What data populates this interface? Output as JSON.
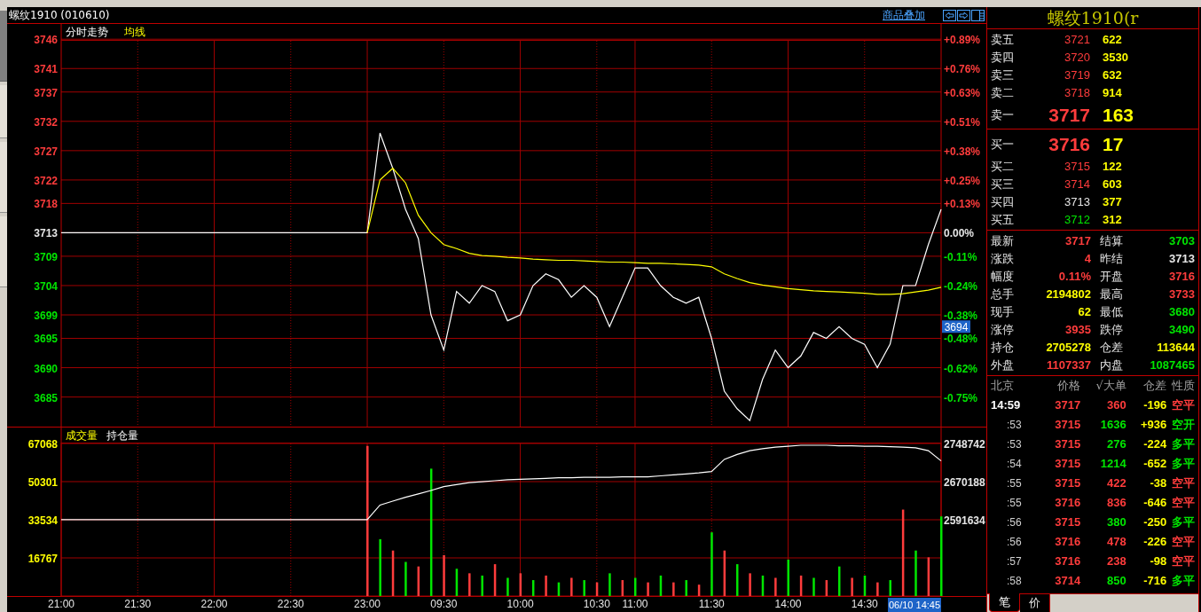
{
  "sidebar_tabs": [
    {
      "selected": true
    },
    {
      "selected": false
    },
    {
      "selected": false
    },
    {
      "selected": false
    }
  ],
  "header": {
    "title": "螺纹1910 (010610)",
    "overlay_link": "商品叠加"
  },
  "price_chart": {
    "percent_ticks": [
      {
        "label": "+0.89%",
        "color": "#ff3c3c"
      },
      {
        "label": "+0.76%",
        "color": "#ff3c3c"
      },
      {
        "label": "+0.63%",
        "color": "#ff3c3c"
      },
      {
        "label": "+0.51%",
        "color": "#ff3c3c"
      },
      {
        "label": "+0.38%",
        "color": "#ff3c3c"
      },
      {
        "label": "+0.25%",
        "color": "#ff3c3c"
      },
      {
        "label": "+0.13%",
        "color": "#ff3c3c"
      },
      {
        "label": "0.00%",
        "color": "#e6e6e6"
      },
      {
        "label": "-0.11%",
        "color": "#00e600"
      },
      {
        "label": "-0.24%",
        "color": "#00e600"
      },
      {
        "label": "-0.38%",
        "color": "#00e600"
      },
      {
        "label": "-0.48%",
        "color": "#00e600"
      },
      {
        "label": "-0.62%",
        "color": "#00e600"
      },
      {
        "label": "-0.75%",
        "color": "#00e600"
      }
    ],
    "chart_data": {
      "type": "line",
      "grid": true,
      "ylim": [
        3679.8,
        3748.6
      ],
      "yticks": [
        3746,
        3741,
        3737,
        3732,
        3727,
        3722,
        3718,
        3713,
        3709,
        3704,
        3699,
        3695,
        3690,
        3685
      ],
      "categories": [
        null,
        null,
        null,
        null,
        null,
        null,
        null,
        null,
        null,
        null,
        null,
        null,
        null,
        null,
        null,
        null,
        null,
        null,
        null,
        null,
        null,
        null,
        null,
        null,
        null,
        null,
        null,
        null,
        null,
        null,
        null,
        null,
        null,
        null,
        null,
        null,
        null,
        null,
        null,
        null,
        null,
        null,
        null,
        null,
        null,
        null,
        null,
        null,
        null,
        null,
        null,
        null,
        null,
        null,
        null,
        null,
        null,
        null,
        null,
        null,
        null,
        null,
        null,
        null,
        null,
        null,
        null,
        null,
        null,
        null
      ],
      "series": [
        {
          "name": "分时走势",
          "color": "#ffffff",
          "values": [
            3713,
            3713,
            3713,
            3713,
            3713,
            3713,
            3713,
            3713,
            3713,
            3713,
            3713,
            3713,
            3713,
            3713,
            3713,
            3713,
            3713,
            3713,
            3713,
            3713,
            3713,
            3713,
            3713,
            3713,
            3713,
            3730,
            3724,
            3717,
            3712,
            3699,
            3693,
            3703,
            3701,
            3704,
            3703,
            3698,
            3699,
            3704,
            3706,
            3705,
            3702,
            3704,
            3702,
            3697,
            3702,
            3707,
            3707,
            3704,
            3702,
            3701,
            3702,
            3695,
            3686,
            3683,
            3681,
            3688,
            3693,
            3690,
            3692,
            3696,
            3695,
            3697,
            3695,
            3694,
            3690,
            3694,
            3704,
            3704,
            3711,
            3717
          ]
        },
        {
          "name": "均线",
          "color": "#ffff00",
          "values": [
            null,
            null,
            null,
            null,
            null,
            null,
            null,
            null,
            null,
            null,
            null,
            null,
            null,
            null,
            null,
            null,
            null,
            null,
            null,
            null,
            null,
            null,
            null,
            null,
            3713,
            3722,
            3724,
            3721.5,
            3716,
            3713,
            3711,
            3710.3,
            3709.5,
            3709.1,
            3709,
            3708.8,
            3708.7,
            3708.5,
            3708.4,
            3708.3,
            3708.3,
            3708.2,
            3708.1,
            3708,
            3708,
            3707.9,
            3707.8,
            3707.8,
            3707.7,
            3707.6,
            3707.5,
            3707.2,
            3706,
            3705.2,
            3704.5,
            3704.1,
            3703.8,
            3703.5,
            3703.3,
            3703.1,
            3703,
            3702.9,
            3702.8,
            3702.7,
            3702.5,
            3702.5,
            3702.6,
            3702.9,
            3703.2,
            3703.7
          ]
        }
      ]
    }
  },
  "volume_chart": {
    "legend_label": "成交量",
    "chart_data": {
      "type": "bar",
      "grid": true,
      "ylim": [
        0,
        67068
      ],
      "yticks": [
        67068,
        50301,
        33534,
        16767
      ],
      "categories": [
        "21:00",
        null,
        null,
        null,
        null,
        null,
        "21:30",
        null,
        null,
        null,
        null,
        null,
        "22:00",
        null,
        null,
        null,
        null,
        null,
        "22:30",
        null,
        null,
        null,
        null,
        null,
        "23:00",
        null,
        null,
        null,
        null,
        null,
        "09:30",
        null,
        null,
        null,
        null,
        null,
        "10:00",
        null,
        null,
        null,
        null,
        null,
        "10:30",
        null,
        null,
        "11:00",
        null,
        null,
        null,
        null,
        null,
        "11:30",
        null,
        null,
        null,
        null,
        null,
        "14:00",
        null,
        null,
        null,
        null,
        null,
        "14:30",
        null,
        null,
        null,
        null,
        null,
        null
      ],
      "series": [
        {
          "color": "#ff3c3c",
          "values": [
            null,
            null,
            null,
            null,
            null,
            null,
            null,
            null,
            null,
            null,
            null,
            null,
            null,
            null,
            null,
            null,
            null,
            null,
            null,
            null,
            null,
            null,
            null,
            null,
            66000,
            null,
            20000,
            null,
            13000,
            null,
            18000,
            null,
            10000,
            null,
            14000,
            null,
            10000,
            null,
            9000,
            null,
            8000,
            null,
            6000,
            null,
            7000,
            null,
            6000,
            null,
            6000,
            null,
            5000,
            null,
            20000,
            null,
            10000,
            null,
            8000,
            null,
            9000,
            null,
            7000,
            null,
            8000,
            null,
            6000,
            null,
            38000,
            null,
            17000,
            null
          ]
        },
        {
          "color": "#00e600",
          "values": [
            null,
            null,
            null,
            null,
            null,
            null,
            null,
            null,
            null,
            null,
            null,
            null,
            null,
            null,
            null,
            null,
            null,
            null,
            null,
            null,
            null,
            null,
            null,
            null,
            null,
            25000,
            null,
            15000,
            null,
            56000,
            null,
            12000,
            null,
            9000,
            null,
            8000,
            null,
            7000,
            null,
            6000,
            null,
            7000,
            null,
            10000,
            null,
            8000,
            null,
            9000,
            null,
            7000,
            null,
            28000,
            null,
            14000,
            null,
            9000,
            null,
            16000,
            null,
            8000,
            null,
            13000,
            null,
            9000,
            null,
            7000,
            null,
            20000,
            null,
            35000
          ]
        }
      ]
    }
  },
  "open_interest_chart": {
    "chart_data": {
      "type": "line",
      "grid": true,
      "ylim": [
        2434526,
        2748742
      ],
      "yticks": [
        2748742,
        2670188,
        2591634
      ],
      "categories": [
        null,
        null,
        null,
        null,
        null,
        null,
        null,
        null,
        null,
        null,
        null,
        null,
        null,
        null,
        null,
        null,
        null,
        null,
        null,
        null,
        null,
        null,
        null,
        null,
        null,
        null,
        null,
        null,
        null,
        null,
        null,
        null,
        null,
        null,
        null,
        null,
        null,
        null,
        null,
        null,
        null,
        null,
        null,
        null,
        null,
        null,
        null,
        null,
        null,
        null,
        null,
        null,
        null,
        null,
        null,
        null,
        null,
        null,
        null,
        null,
        null,
        null,
        null,
        null,
        null,
        null,
        null,
        null,
        null,
        null
      ],
      "series": [
        {
          "name": "持仓量",
          "color": "#ffffff",
          "values": [
            2592000,
            2592000,
            2592000,
            2592000,
            2592000,
            2592000,
            2592000,
            2592000,
            2592000,
            2592000,
            2592000,
            2592000,
            2592000,
            2592000,
            2592000,
            2592000,
            2592000,
            2592000,
            2592000,
            2592000,
            2592000,
            2592000,
            2592000,
            2592000,
            2592000,
            2622000,
            2630000,
            2638000,
            2645000,
            2652000,
            2660000,
            2664000,
            2668000,
            2670000,
            2672000,
            2674000,
            2675000,
            2676000,
            2677000,
            2678000,
            2678000,
            2679000,
            2679000,
            2679000,
            2680000,
            2680000,
            2680000,
            2682000,
            2684000,
            2686000,
            2688000,
            2691000,
            2716000,
            2726000,
            2734000,
            2738000,
            2741000,
            2743000,
            2745000,
            2745000,
            2745000,
            2744000,
            2744000,
            2743000,
            2743000,
            2742000,
            2741000,
            2740000,
            2734000,
            2713000
          ]
        }
      ]
    }
  },
  "cursor": {
    "price": "3694",
    "time": "06/10 14:45"
  },
  "quote_panel": {
    "title": "螺纹1910(r",
    "sell": [
      {
        "kind": "level",
        "label": "卖五",
        "price": "3721",
        "color": "#ff3c3c",
        "volume": "622"
      },
      {
        "kind": "level",
        "label": "卖四",
        "price": "3720",
        "color": "#ff3c3c",
        "volume": "3530"
      },
      {
        "kind": "level",
        "label": "卖三",
        "price": "3719",
        "color": "#ff3c3c",
        "volume": "632"
      },
      {
        "kind": "level",
        "label": "卖二",
        "price": "3718",
        "color": "#ff3c3c",
        "volume": "914"
      },
      {
        "kind": "best",
        "label": "卖一",
        "price": "3717",
        "color": "#ff3c3c",
        "volume": "163"
      }
    ],
    "buy": [
      {
        "kind": "best",
        "label": "买一",
        "price": "3716",
        "color": "#ff3c3c",
        "volume": "17"
      },
      {
        "kind": "level",
        "label": "买二",
        "price": "3715",
        "color": "#ff3c3c",
        "volume": "122"
      },
      {
        "kind": "level",
        "label": "买三",
        "price": "3714",
        "color": "#ff3c3c",
        "volume": "603"
      },
      {
        "kind": "level",
        "label": "买四",
        "price": "3713",
        "color": "#e6e6e6",
        "volume": "377"
      },
      {
        "kind": "level",
        "label": "买五",
        "price": "3712",
        "color": "#00e600",
        "volume": "312"
      }
    ],
    "stats": [
      {
        "label": "最新",
        "value": "3717",
        "color": "#ff3c3c"
      },
      {
        "label": "结算",
        "value": "3703",
        "color": "#00e600"
      },
      {
        "label": "涨跌",
        "value": "4",
        "color": "#ff3c3c"
      },
      {
        "label": "昨结",
        "value": "3713",
        "color": "#e6e6e6"
      },
      {
        "label": "幅度",
        "value": "0.11%",
        "color": "#ff3c3c"
      },
      {
        "label": "开盘",
        "value": "3716",
        "color": "#ff3c3c"
      },
      {
        "label": "总手",
        "value": "2194802",
        "color": "#ffff00"
      },
      {
        "label": "最高",
        "value": "3733",
        "color": "#ff3c3c"
      },
      {
        "label": "现手",
        "value": "62",
        "color": "#ffff00"
      },
      {
        "label": "最低",
        "value": "3680",
        "color": "#00e600"
      },
      {
        "label": "涨停",
        "value": "3935",
        "color": "#ff3c3c"
      },
      {
        "label": "跌停",
        "value": "3490",
        "color": "#00e600"
      },
      {
        "label": "持仓",
        "value": "2705278",
        "color": "#ffff00"
      },
      {
        "label": "仓差",
        "value": "113644",
        "color": "#ffff00"
      },
      {
        "label": "外盘",
        "value": "1107337",
        "color": "#ff3c3c"
      },
      {
        "label": "内盘",
        "value": "1087465",
        "color": "#00e600"
      }
    ]
  },
  "trades": {
    "columns": [
      "北京",
      "价格",
      "√大单",
      "仓差",
      "性质"
    ],
    "rows": [
      {
        "time": "14:59",
        "price": "3717",
        "volume": {
          "value": "360",
          "color": "#ff3c3c"
        },
        "oi_change": "-196",
        "nature": {
          "value": "空平",
          "color": "#ff3c3c"
        }
      },
      {
        "time": ":53",
        "price": "3715",
        "volume": {
          "value": "1636",
          "color": "#00e600"
        },
        "oi_change": "+936",
        "nature": {
          "value": "空开",
          "color": "#00e600"
        }
      },
      {
        "time": ":53",
        "price": "3715",
        "volume": {
          "value": "276",
          "color": "#00e600"
        },
        "oi_change": "-224",
        "nature": {
          "value": "多平",
          "color": "#00e600"
        }
      },
      {
        "time": ":54",
        "price": "3715",
        "volume": {
          "value": "1214",
          "color": "#00e600"
        },
        "oi_change": "-652",
        "nature": {
          "value": "多平",
          "color": "#00e600"
        }
      },
      {
        "time": ":55",
        "price": "3715",
        "volume": {
          "value": "422",
          "color": "#ff3c3c"
        },
        "oi_change": "-38",
        "nature": {
          "value": "空平",
          "color": "#ff3c3c"
        }
      },
      {
        "time": ":55",
        "price": "3716",
        "volume": {
          "value": "836",
          "color": "#ff3c3c"
        },
        "oi_change": "-646",
        "nature": {
          "value": "空平",
          "color": "#ff3c3c"
        }
      },
      {
        "time": ":56",
        "price": "3715",
        "volume": {
          "value": "380",
          "color": "#00e600"
        },
        "oi_change": "-250",
        "nature": {
          "value": "多平",
          "color": "#00e600"
        }
      },
      {
        "time": ":56",
        "price": "3716",
        "volume": {
          "value": "478",
          "color": "#ff3c3c"
        },
        "oi_change": "-226",
        "nature": {
          "value": "空平",
          "color": "#ff3c3c"
        }
      },
      {
        "time": ":57",
        "price": "3716",
        "volume": {
          "value": "238",
          "color": "#ff3c3c"
        },
        "oi_change": "-98",
        "nature": {
          "value": "空平",
          "color": "#ff3c3c"
        }
      },
      {
        "time": ":58",
        "price": "3714",
        "volume": {
          "value": "850",
          "color": "#00e600"
        },
        "oi_change": "-716",
        "nature": {
          "value": "多平",
          "color": "#00e600"
        }
      }
    ],
    "tabs": [
      {
        "label": "笔",
        "selected": true
      },
      {
        "label": "价",
        "selected": false
      }
    ]
  }
}
